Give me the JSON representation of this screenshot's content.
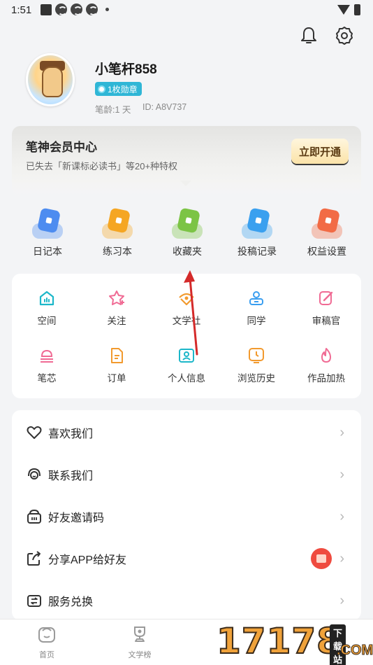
{
  "status_bar": {
    "time": "1:51"
  },
  "profile": {
    "username": "小笔杆858",
    "badge": "1枚勋章",
    "age": "笔龄:1 天",
    "id": "ID: A8V737"
  },
  "vip": {
    "title": "笔神会员中心",
    "description": "已失去「新课标必读书」等20+种特权",
    "button": "立即开通"
  },
  "quick_items": [
    {
      "label": "日记本",
      "icon": "diary-icon",
      "color": "#4d8cf0"
    },
    {
      "label": "练习本",
      "icon": "exercise-book-icon",
      "color": "#f5a623"
    },
    {
      "label": "收藏夹",
      "icon": "favorites-icon",
      "color": "#7cc445"
    },
    {
      "label": "投稿记录",
      "icon": "submission-record-icon",
      "color": "#3aa0ef"
    },
    {
      "label": "权益设置",
      "icon": "benefits-settings-icon",
      "color": "#f26b45"
    }
  ],
  "grid_row1": [
    {
      "label": "空间",
      "icon": "space-icon",
      "color": "#1cb7c9"
    },
    {
      "label": "关注",
      "icon": "follow-icon",
      "color": "#f06b94"
    },
    {
      "label": "文学社",
      "icon": "literary-club-icon",
      "color": "#f29a2e"
    },
    {
      "label": "同学",
      "icon": "classmate-icon",
      "color": "#3a9ef0"
    },
    {
      "label": "审稿官",
      "icon": "reviewer-icon",
      "color": "#f06b94"
    }
  ],
  "grid_row2": [
    {
      "label": "笔芯",
      "icon": "pen-refill-icon",
      "color": "#f06b94"
    },
    {
      "label": "订单",
      "icon": "order-icon",
      "color": "#f29a2e"
    },
    {
      "label": "个人信息",
      "icon": "personal-info-icon",
      "color": "#1cb7c9"
    },
    {
      "label": "浏览历史",
      "icon": "browse-history-icon",
      "color": "#f29a2e"
    },
    {
      "label": "作品加热",
      "icon": "promote-work-icon",
      "color": "#f06b94"
    }
  ],
  "list_items": [
    {
      "label": "喜欢我们",
      "icon": "heart-icon"
    },
    {
      "label": "联系我们",
      "icon": "headset-icon"
    },
    {
      "label": "好友邀请码",
      "icon": "invite-code-icon"
    },
    {
      "label": "分享APP给好友",
      "icon": "share-icon",
      "has_gift": true
    },
    {
      "label": "服务兑换",
      "icon": "redeem-icon"
    }
  ],
  "bottom_nav": [
    {
      "label": "首页",
      "icon": "home-icon"
    },
    {
      "label": "文学榜",
      "icon": "ranking-icon"
    }
  ],
  "watermark": {
    "number": "17178",
    "tag": "下载站",
    "domain": ".COM"
  }
}
